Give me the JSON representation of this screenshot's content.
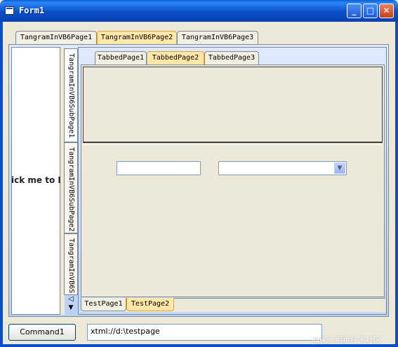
{
  "window": {
    "title": "Form1"
  },
  "controls": {
    "minimize": "_",
    "maximize": "□",
    "close": "✕"
  },
  "outer_tabs": [
    "TangramInVB6Page1",
    "TangramInVB6Page2",
    "TangramInVB6Page3"
  ],
  "left_label": "ick me to D",
  "side_tabs": [
    "TangramInVB6SubPage1",
    "TangramInVB6SubPage2",
    "TangramInVB6S"
  ],
  "inner_tabs": [
    "TabbedPage1",
    "TabbedPage2",
    "TabbedPage3"
  ],
  "bottom_tabs": [
    "TestPage1",
    "TestPage2"
  ],
  "command_button": "Command1",
  "url_field": {
    "value": "xtml://d:\\testpage"
  },
  "watermark": "@稀土掘金技术社区",
  "icons": [
    "app-icon",
    "minimize-icon",
    "maximize-icon",
    "close-icon",
    "scroll-up-icon",
    "scroll-down-icon",
    "dropdown-arrow-icon"
  ]
}
